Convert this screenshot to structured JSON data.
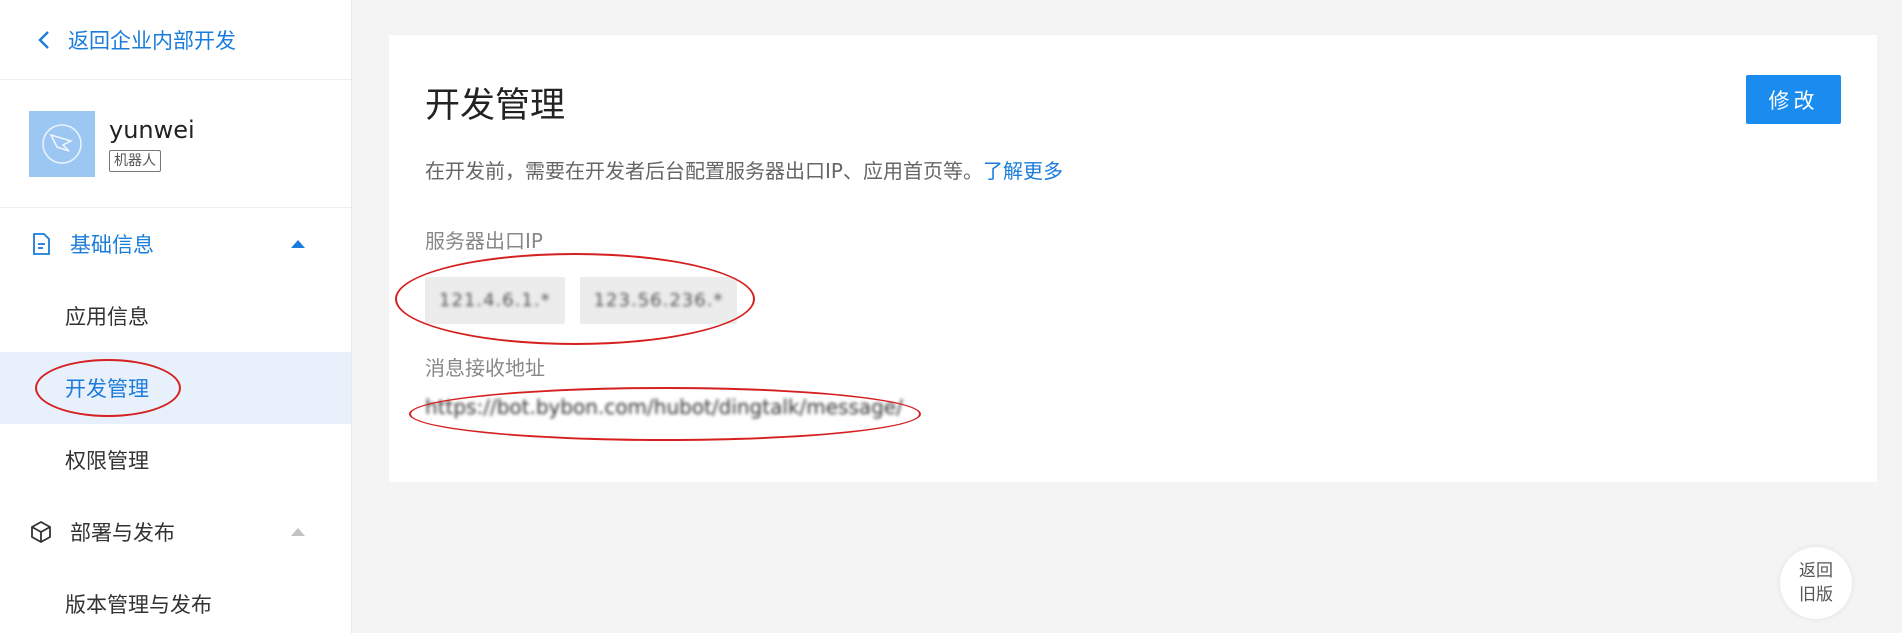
{
  "sidebar": {
    "back_label": "返回企业内部开发",
    "app": {
      "name": "yunwei",
      "badge": "机器人"
    },
    "groups": [
      {
        "label": "基础信息",
        "icon": "document-icon",
        "expanded": true,
        "items": [
          {
            "label": "应用信息",
            "selected": false
          },
          {
            "label": "开发管理",
            "selected": true
          },
          {
            "label": "权限管理",
            "selected": false
          }
        ]
      },
      {
        "label": "部署与发布",
        "icon": "cube-icon",
        "expanded": true,
        "items": [
          {
            "label": "版本管理与发布",
            "selected": false
          }
        ]
      }
    ]
  },
  "main": {
    "title": "开发管理",
    "edit_label": "修改",
    "description": "在开发前，需要在开发者后台配置服务器出口IP、应用首页等。",
    "learn_more": "了解更多",
    "server_ip_label": "服务器出口IP",
    "server_ips": [
      "121.4.6.1.*",
      "123.56.236.*"
    ],
    "message_url_label": "消息接收地址",
    "message_url": "https://bot.bybon.com/hubot/dingtalk/message/"
  },
  "float_button": {
    "line1": "返回",
    "line2": "旧版"
  },
  "colors": {
    "accent": "#1a7cdb",
    "button": "#1a8cf0",
    "selected_bg": "#e7f0fb",
    "annotation": "#d62020"
  }
}
